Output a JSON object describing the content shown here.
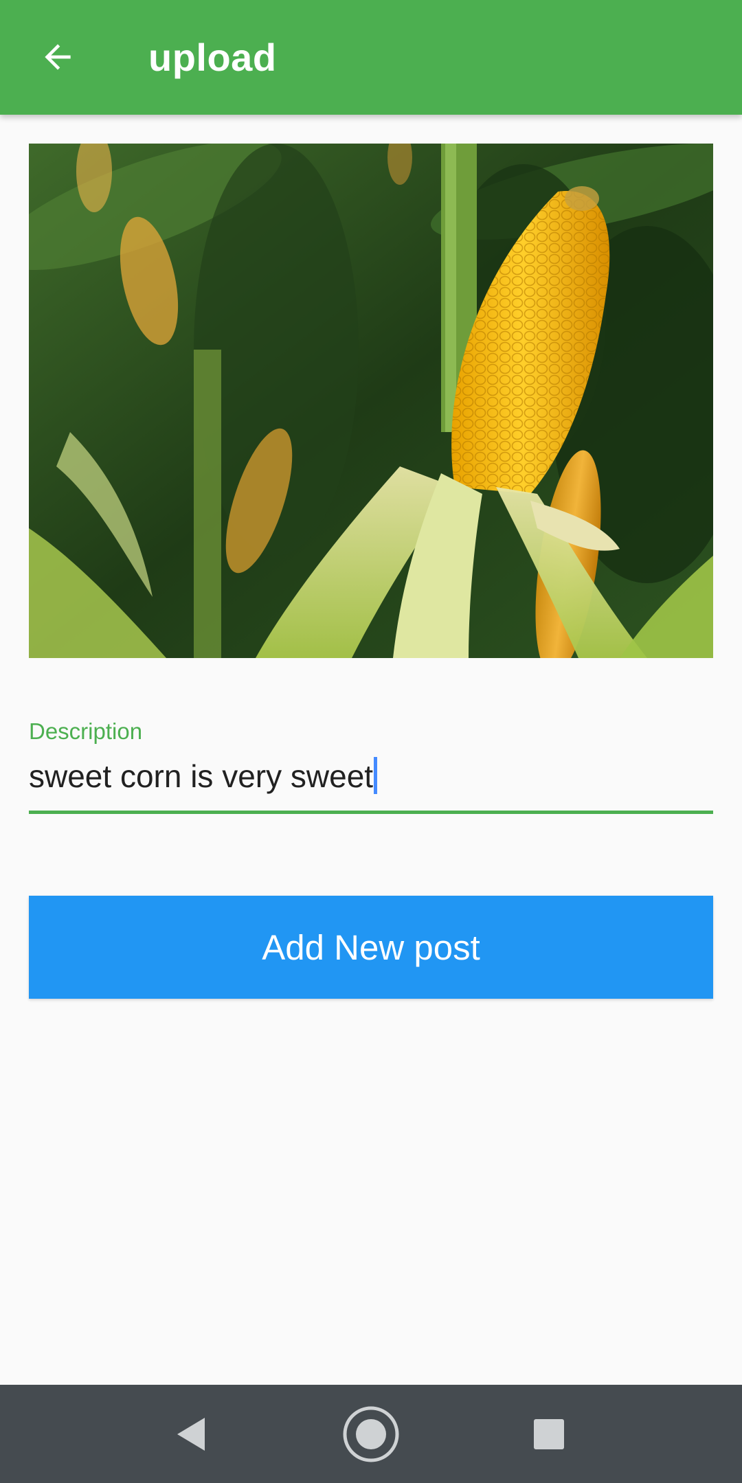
{
  "app_bar": {
    "title": "upload",
    "back_icon": "arrow-left-icon",
    "color": "#4caf50"
  },
  "preview_image": {
    "subject": "corn-field-photo"
  },
  "description_field": {
    "label": "Description",
    "value": "sweet corn is very sweet",
    "accent": "#4caf50"
  },
  "submit_button": {
    "label": "Add New post",
    "color": "#2196f3"
  },
  "system_nav": {
    "back_icon": "triangle-back-icon",
    "home_icon": "circle-home-icon",
    "recents_icon": "square-recents-icon",
    "color": "#454b50"
  }
}
